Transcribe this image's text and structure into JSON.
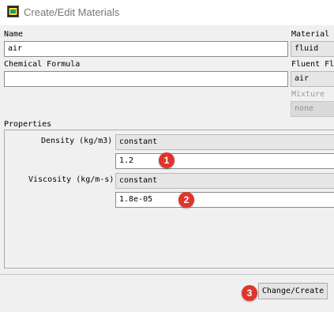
{
  "window": {
    "title": "Create/Edit Materials"
  },
  "form": {
    "name_label": "Name",
    "name_value": "air",
    "formula_label": "Chemical Formula",
    "formula_value": "",
    "material_type_label": "Material",
    "material_type_value": "fluid",
    "fluent_label": "Fluent Fl",
    "fluent_value": "air",
    "mixture_label": "Mixture",
    "mixture_value": "none"
  },
  "properties": {
    "group_label": "Properties",
    "density_label": "Density (kg/m3)",
    "density_method": "constant",
    "density_value": "1.2",
    "viscosity_label": "Viscosity (kg/m-s)",
    "viscosity_method": "constant",
    "viscosity_value": "1.8e-05"
  },
  "buttons": {
    "change_create": "Change/Create"
  },
  "annotations": {
    "badge_1": "1",
    "badge_2": "2",
    "badge_3": "3",
    "color": "#e0352b"
  },
  "icons": [
    "materials-app-icon"
  ]
}
